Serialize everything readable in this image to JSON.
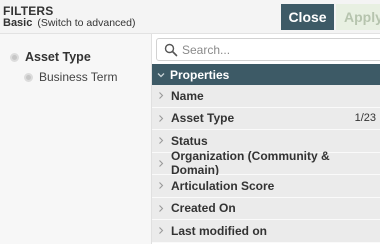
{
  "header": {
    "title": "FILTERS",
    "mode": "Basic",
    "switch_label": "(Switch to advanced)",
    "close_label": "Close",
    "apply_label": "Apply"
  },
  "tree": {
    "items": [
      {
        "label": "Asset Type",
        "level": 1
      },
      {
        "label": "Business Term",
        "level": 2
      }
    ]
  },
  "search": {
    "placeholder": "Search...",
    "value": ""
  },
  "properties": {
    "header_label": "Properties",
    "items": [
      {
        "label": "Name",
        "count": ""
      },
      {
        "label": "Asset Type",
        "count": "1/23"
      },
      {
        "label": "Status",
        "count": ""
      },
      {
        "label": "Organization (Community & Domain)",
        "count": ""
      },
      {
        "label": "Articulation Score",
        "count": ""
      },
      {
        "label": "Created On",
        "count": ""
      },
      {
        "label": "Last modified on",
        "count": ""
      }
    ]
  },
  "colors": {
    "primary": "#3d5a66",
    "apply_bg": "#e8f0e2",
    "row_bg": "#ebebeb",
    "panel_bg": "#f7f7f7"
  },
  "icons": {
    "search": "search-icon",
    "expand": "chevron-down-icon",
    "collapsed": "chevron-right-icon",
    "bullet": "bullet-icon"
  }
}
